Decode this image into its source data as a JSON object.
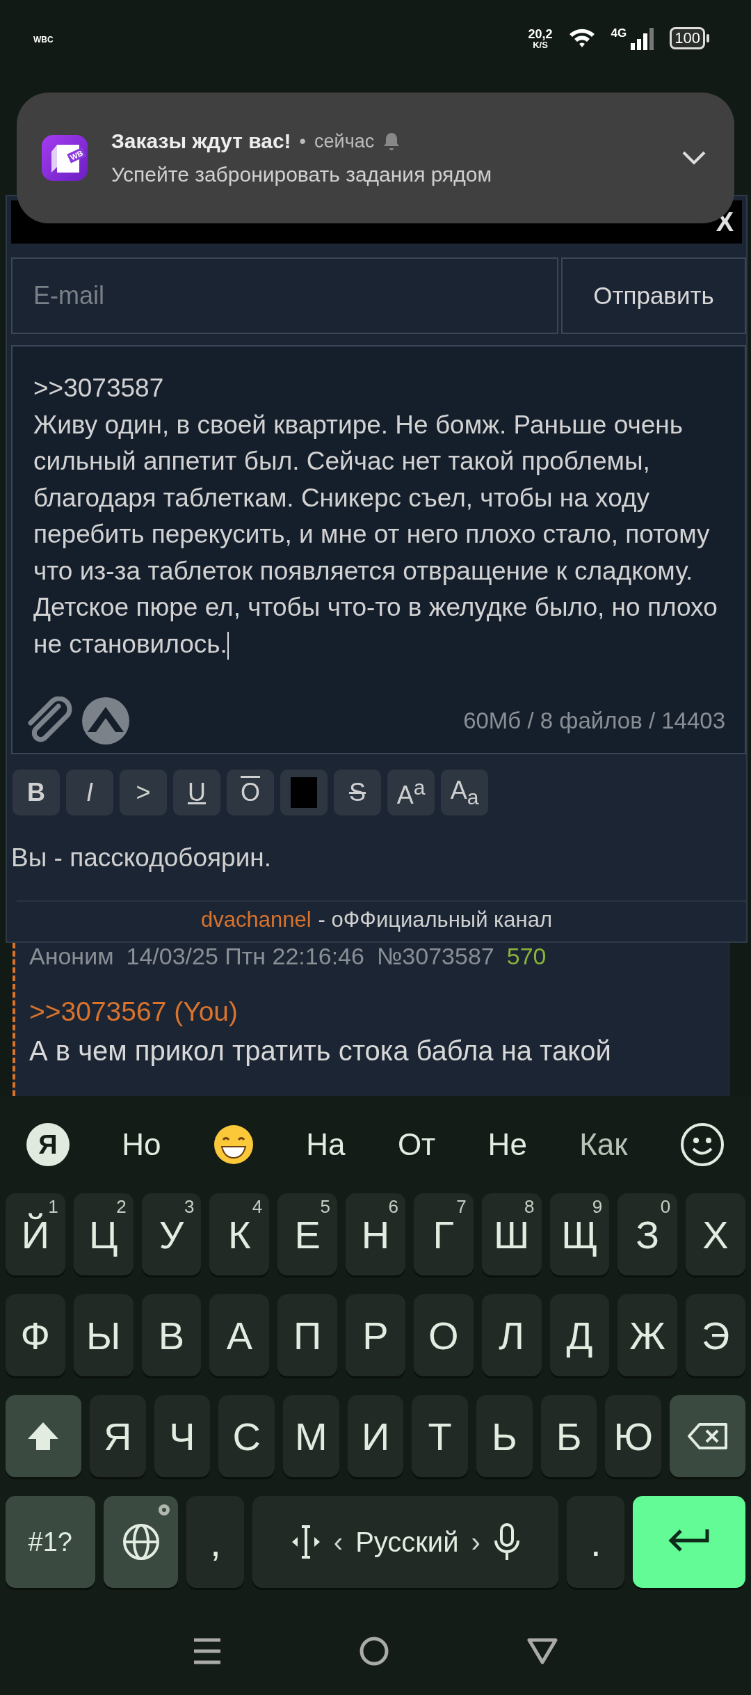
{
  "status_bar": {
    "carrier": "WBC",
    "speed": "20,2",
    "speed_unit": "K/S",
    "network": "4G",
    "battery": "100"
  },
  "notification": {
    "app_badge": "WB",
    "title": "Заказы ждут вас!",
    "separator": "•",
    "time": "сейчас",
    "text": "Успейте забронировать задания рядом"
  },
  "reply_form": {
    "close": "X",
    "email_placeholder": "E-mail",
    "submit": "Отправить",
    "message": ">>3073587\nЖиву один, в своей квартире. Не бомж. Раньше очень сильный аппетит был. Сейчас нет такой проблемы, благодаря таблеткам. Сникерс съел, чтобы на ходу перебить перекусить, и мне от него плохо стало, потому что из-за таблеток появляется отвращение к сладкому.\nДетское пюре ел, чтобы что-то в желудке было, но плохо не становилось.",
    "limits": "60Мб / 8 файлов / 14403",
    "format_buttons": [
      {
        "kind": "bold",
        "label": "B"
      },
      {
        "kind": "italic",
        "label": "I"
      },
      {
        "kind": "quote",
        "label": ">"
      },
      {
        "kind": "underline",
        "label": "U"
      },
      {
        "kind": "overline",
        "label": "O"
      },
      {
        "kind": "spoiler"
      },
      {
        "kind": "strike",
        "label": "S"
      },
      {
        "kind": "sup",
        "label": "A$^{a}$"
      },
      {
        "kind": "sub",
        "label": "A$_{a}$"
      }
    ],
    "passcode_note": "Вы - пасскодобоярин.",
    "footer_link": "dvachannel",
    "footer_text": "- оФФициальный канал"
  },
  "post": {
    "author": "Аноним",
    "date": "14/03/25 Птн 22:16:46",
    "number": "№3073587",
    "count": "570",
    "reply_link": ">>3073567 (You)",
    "text": "А в чем прикол тратить стока бабла на такой"
  },
  "keyboard": {
    "logo": "Я",
    "suggestions": [
      {
        "kind": "word",
        "text": "Но"
      },
      {
        "kind": "emoji"
      },
      {
        "kind": "word",
        "text": "На"
      },
      {
        "kind": "word",
        "text": "От"
      },
      {
        "kind": "word",
        "text": "Не"
      },
      {
        "kind": "word",
        "text": "Как"
      }
    ],
    "rows": [
      [
        {
          "label": "Й",
          "hint": "1"
        },
        {
          "label": "Ц",
          "hint": "2"
        },
        {
          "label": "У",
          "hint": "3"
        },
        {
          "label": "К",
          "hint": "4"
        },
        {
          "label": "Е",
          "hint": "5"
        },
        {
          "label": "Н",
          "hint": "6"
        },
        {
          "label": "Г",
          "hint": "7"
        },
        {
          "label": "Ш",
          "hint": "8"
        },
        {
          "label": "Щ",
          "hint": "9"
        },
        {
          "label": "З",
          "hint": "0"
        },
        {
          "label": "Х"
        }
      ],
      [
        {
          "label": "Ф"
        },
        {
          "label": "Ы"
        },
        {
          "label": "В"
        },
        {
          "label": "А"
        },
        {
          "label": "П"
        },
        {
          "label": "Р"
        },
        {
          "label": "О"
        },
        {
          "label": "Л"
        },
        {
          "label": "Д"
        },
        {
          "label": "Ж"
        },
        {
          "label": "Э"
        }
      ],
      [
        {
          "kind": "shift"
        },
        {
          "label": "Я"
        },
        {
          "label": "Ч"
        },
        {
          "label": "С"
        },
        {
          "label": "М"
        },
        {
          "label": "И"
        },
        {
          "label": "Т"
        },
        {
          "label": "Ь"
        },
        {
          "label": "Б"
        },
        {
          "label": "Ю"
        },
        {
          "kind": "backspace"
        }
      ]
    ],
    "symbols": "#1?",
    "comma": ",",
    "language": "Русский",
    "prev": "‹",
    "next": "›",
    "period": "."
  }
}
